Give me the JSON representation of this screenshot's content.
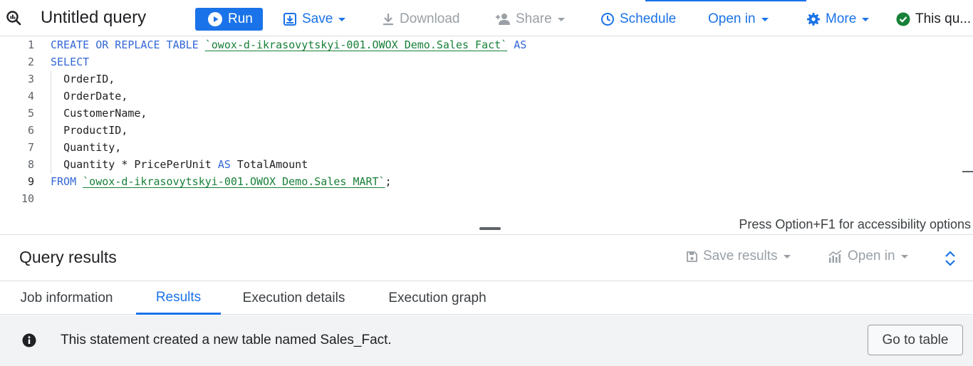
{
  "toolbar": {
    "title": "Untitled query",
    "run_label": "Run",
    "save_label": "Save",
    "download_label": "Download",
    "share_label": "Share",
    "schedule_label": "Schedule",
    "open_in_label": "Open in",
    "more_label": "More",
    "status_label": "This qu..."
  },
  "editor": {
    "line_numbers": [
      "1",
      "2",
      "3",
      "4",
      "5",
      "6",
      "7",
      "8",
      "9",
      "10"
    ],
    "active_line": "9",
    "lines": {
      "l1": {
        "kw": "CREATE OR REPLACE TABLE",
        "table": "`owox-d-ikrasovytskyi-001.OWOX_Demo.Sales_Fact`",
        "kw2": "AS"
      },
      "l2": {
        "kw": "SELECT"
      },
      "l3": {
        "text": "OrderID,"
      },
      "l4": {
        "text": "OrderDate,"
      },
      "l5": {
        "text": "CustomerName,"
      },
      "l6": {
        "text": "ProductID,"
      },
      "l7": {
        "text": "Quantity,"
      },
      "l8": {
        "pre": "Quantity * PricePerUnit",
        "kw": "AS",
        "post": "TotalAmount"
      },
      "l9": {
        "kw": "FROM",
        "table": "`owox-d-ikrasovytskyi-001.OWOX_Demo.Sales_MART`",
        "post": ";"
      }
    },
    "accessibility_hint": "Press Option+F1 for accessibility options"
  },
  "results": {
    "title": "Query results",
    "save_results_label": "Save results",
    "open_in_label": "Open in",
    "tabs": [
      {
        "label": "Job information"
      },
      {
        "label": "Results"
      },
      {
        "label": "Execution details"
      },
      {
        "label": "Execution graph"
      }
    ],
    "active_tab": "Results",
    "info_message": "This statement created a new table named Sales_Fact.",
    "go_to_table_label": "Go to table"
  },
  "colors": {
    "accent": "#1a73e8",
    "keyword": "#3367d6",
    "string": "#188038",
    "success": "#188038",
    "disabled": "#9aa0a6"
  },
  "icons": {
    "query": "query-icon",
    "run": "play-icon",
    "save": "save-icon",
    "download": "download-icon",
    "share": "person-add-icon",
    "schedule": "clock-icon",
    "more": "gear-icon",
    "status": "check-circle-icon",
    "save_results": "floppy-icon",
    "open_in_results": "chart-icon",
    "expand": "unfold-icon",
    "info": "info-icon"
  }
}
